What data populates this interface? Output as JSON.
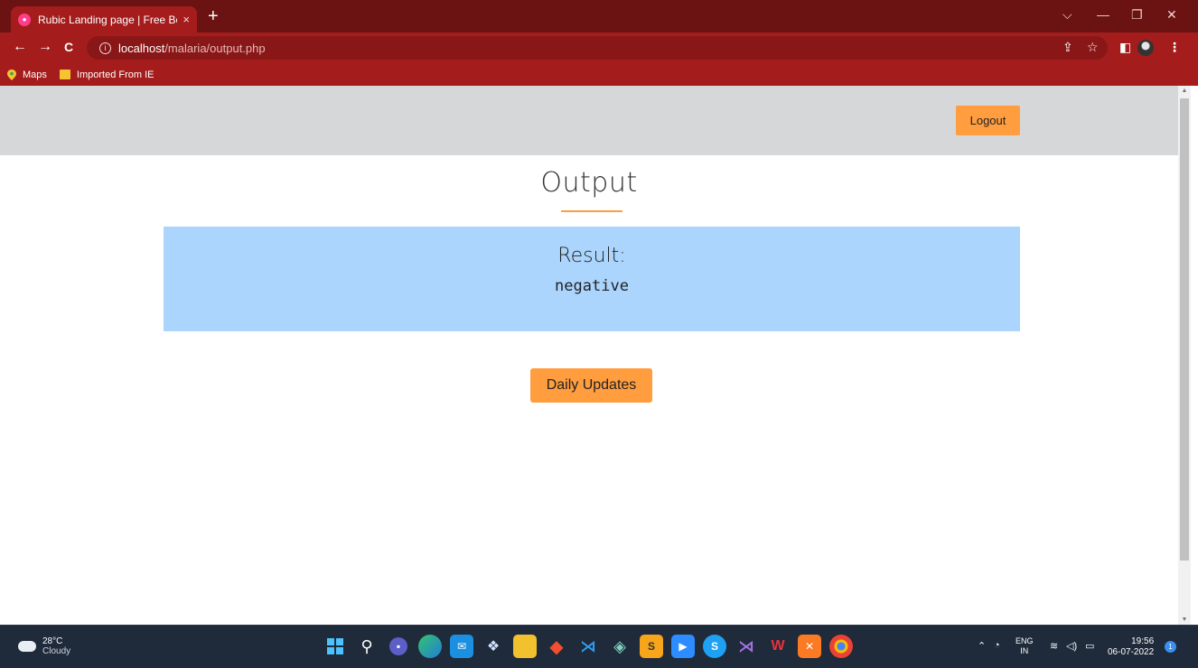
{
  "browser": {
    "tab_title": "Rubic Landing page | Free Bootst",
    "tab_close": "×",
    "new_tab": "+",
    "window_controls": {
      "minimize_dropdown": "⌵",
      "minimize": "—",
      "restore": "❐",
      "close": "✕"
    },
    "nav": {
      "back": "←",
      "forward": "→",
      "reload": "C"
    },
    "url_host": "localhost",
    "url_path": "/malaria/output.php",
    "bookmarks": [
      {
        "label": "Maps",
        "icon": "map-pin-icon"
      },
      {
        "label": "Imported From IE",
        "icon": "folder-icon"
      }
    ]
  },
  "page": {
    "logout_label": "Logout",
    "heading": "Output",
    "result_label": "Result:",
    "result_value": "negative",
    "daily_updates_label": "Daily Updates",
    "colors": {
      "accent": "#ff9d3f",
      "result_bg": "#abd5fd",
      "topbar_bg": "#d6d7d8",
      "chrome": "#a51c1c"
    }
  },
  "taskbar": {
    "weather_temp": "28°C",
    "weather_desc": "Cloudy",
    "lang_top": "ENG",
    "lang_bottom": "IN",
    "time": "19:56",
    "date": "06-07-2022",
    "notification_count": "1",
    "apps": [
      "windows-start-icon",
      "search-icon",
      "teams-chat-icon",
      "edge-icon",
      "mail-icon",
      "dropbox-icon",
      "file-explorer-icon",
      "git-icon",
      "vscode-icon",
      "gitkraken-icon",
      "sublime-icon",
      "zoom-icon",
      "skype-icon",
      "visual-studio-icon",
      "wps-office-icon",
      "xampp-icon",
      "chrome-icon"
    ]
  }
}
